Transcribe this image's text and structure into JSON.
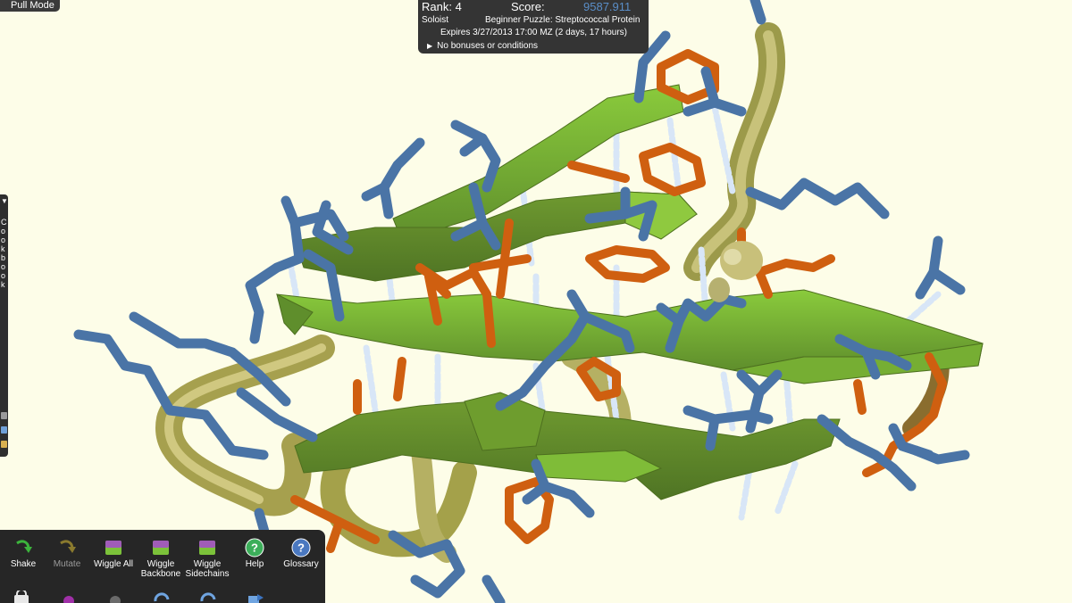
{
  "pull_mode": {
    "label": "Pull Mode"
  },
  "score_panel": {
    "rank": "Rank: 4",
    "score_label": "Score:",
    "score_value": "9587.911",
    "mode": "Soloist",
    "puzzle": "Beginner Puzzle: Streptococcal Protein",
    "expires": "Expires 3/27/2013 17:00 MZ (2 days, 17 hours)",
    "bonus": "No bonuses or conditions",
    "score_color": "#5a8ec8"
  },
  "cookbook": {
    "letters": "Cookbook"
  },
  "toolbar": {
    "tools": [
      {
        "id": "shake",
        "label": "Shake",
        "icon": "shake-arrow-icon",
        "enabled": true
      },
      {
        "id": "mutate",
        "label": "Mutate",
        "icon": "mutate-arrow-icon",
        "enabled": false
      },
      {
        "id": "wiggle-all",
        "label": "Wiggle All",
        "icon": "wiggle-all-icon",
        "enabled": true
      },
      {
        "id": "wiggle-backbone",
        "label": "Wiggle Backbone",
        "icon": "wiggle-backbone-icon",
        "enabled": true
      },
      {
        "id": "wiggle-sidechains",
        "label": "Wiggle Sidechains",
        "icon": "wiggle-sidechains-icon",
        "enabled": true
      },
      {
        "id": "help",
        "label": "Help",
        "icon": "help-icon",
        "enabled": true
      },
      {
        "id": "glossary",
        "label": "Glossary",
        "icon": "glossary-icon",
        "enabled": true
      }
    ]
  },
  "colors": {
    "background": "#fdfde8",
    "sheet_light": "#7cc23a",
    "sheet_dark": "#5e8a2a",
    "tube": "#b0ab5a",
    "sidechain_blue": "#4a74a6",
    "sidechain_orange": "#cf5f10",
    "hbond": "#dbe7f5"
  }
}
